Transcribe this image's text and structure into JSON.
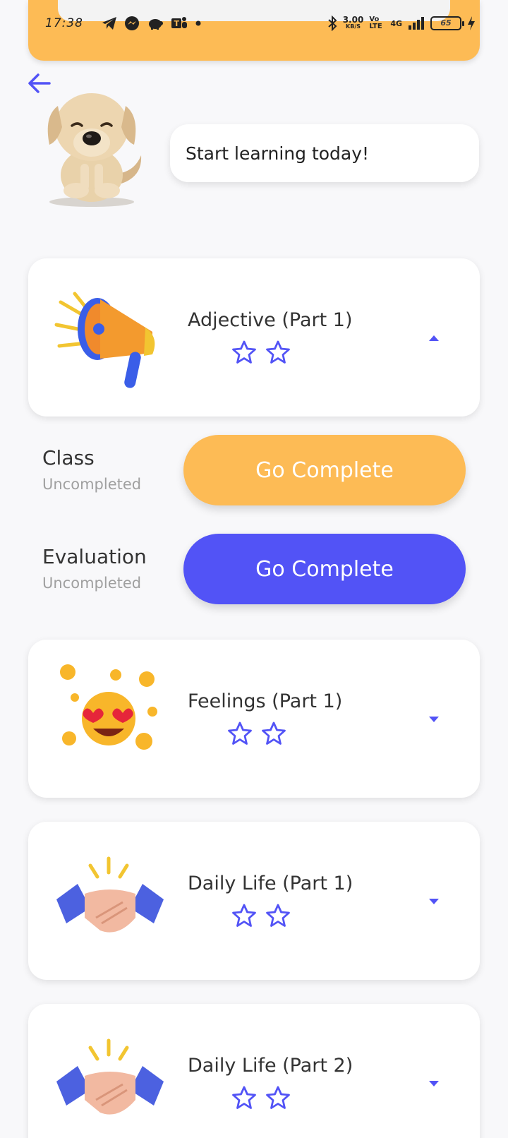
{
  "status": {
    "time": "17:38",
    "speed_value": "3.00",
    "speed_unit": "KB/S",
    "volte": "Vo LTE",
    "network": "4G",
    "battery": "65"
  },
  "bubble": {
    "text": "Start learning today!"
  },
  "lessons": [
    {
      "title": "Adjective (Part 1)",
      "stars": 2,
      "expanded": true
    },
    {
      "title": "Feelings (Part 1)",
      "stars": 2,
      "expanded": false
    },
    {
      "title": "Daily Life (Part 1)",
      "stars": 2,
      "expanded": false
    },
    {
      "title": "Daily Life (Part 2)",
      "stars": 2,
      "expanded": false
    }
  ],
  "tasks": [
    {
      "label": "Class",
      "status": "Uncompleted",
      "button": "Go Complete"
    },
    {
      "label": "Evaluation",
      "status": "Uncompleted",
      "button": "Go Complete"
    }
  ],
  "colors": {
    "accent_blue": "#5253f6",
    "accent_orange": "#fdbb55",
    "background": "#f8f8fa"
  }
}
